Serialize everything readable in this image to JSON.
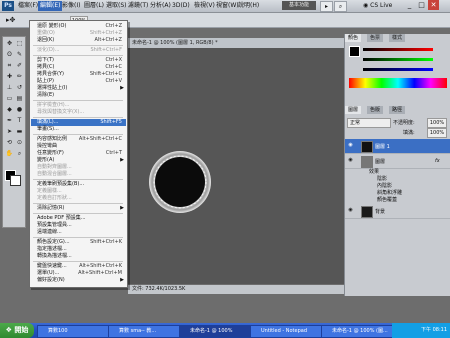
{
  "menubar": {
    "logo": "Ps",
    "items": [
      {
        "label": "檔案(F)",
        "active": false
      },
      {
        "label": "編輯(E)",
        "active": true
      },
      {
        "label": "影像(I)",
        "active": false
      },
      {
        "label": "圖層(L)",
        "active": false
      },
      {
        "label": "選取(S)",
        "active": false
      },
      {
        "label": "濾鏡(T)",
        "active": false
      },
      {
        "label": "分析(A)",
        "active": false
      },
      {
        "label": "3D(D)",
        "active": false
      },
      {
        "label": "檢視(V)",
        "active": false
      },
      {
        "label": "視窗(W)",
        "active": false
      },
      {
        "label": "說明(H)",
        "active": false
      }
    ],
    "workspace": "基本功能",
    "cs_live": "CS Live"
  },
  "options": {
    "zoom": "100%"
  },
  "document": {
    "tab": "未命名-1 @ 100% (圖層 1, RGB/8) *",
    "status": "文件: 732.4K/1023.5K"
  },
  "edit_menu": {
    "items": [
      {
        "label": "還原 變形(O)",
        "shortcut": "Ctrl+Z",
        "disabled": false
      },
      {
        "label": "重做(O)",
        "shortcut": "Shift+Ctrl+Z",
        "disabled": true
      },
      {
        "label": "退回(K)",
        "shortcut": "Alt+Ctrl+Z",
        "disabled": false
      },
      {
        "sep": true
      },
      {
        "label": "淡化(D)...",
        "shortcut": "Shift+Ctrl+F",
        "disabled": true
      },
      {
        "sep": true
      },
      {
        "label": "剪下(T)",
        "shortcut": "Ctrl+X",
        "disabled": false
      },
      {
        "label": "拷貝(C)",
        "shortcut": "Ctrl+C",
        "disabled": false
      },
      {
        "label": "拷貝合併(Y)",
        "shortcut": "Shift+Ctrl+C",
        "disabled": false
      },
      {
        "label": "貼上(P)",
        "shortcut": "Ctrl+V",
        "disabled": false
      },
      {
        "label": "選擇性貼上(I)",
        "shortcut": "",
        "disabled": false,
        "submenu": true
      },
      {
        "label": "清除(E)",
        "shortcut": "",
        "disabled": false
      },
      {
        "sep": true
      },
      {
        "label": "拼字檢查(H)...",
        "shortcut": "",
        "disabled": true
      },
      {
        "label": "尋找與替換文字(X)...",
        "shortcut": "",
        "disabled": true
      },
      {
        "sep": true
      },
      {
        "label": "填滿(L)...",
        "shortcut": "Shift+F5",
        "disabled": false,
        "highlight": true
      },
      {
        "label": "筆畫(S)...",
        "shortcut": "",
        "disabled": false
      },
      {
        "sep": true
      },
      {
        "label": "內容感知比例",
        "shortcut": "Alt+Shift+Ctrl+C",
        "disabled": false
      },
      {
        "label": "操控彎曲",
        "shortcut": "",
        "disabled": false
      },
      {
        "label": "任意變形(F)",
        "shortcut": "Ctrl+T",
        "disabled": false
      },
      {
        "label": "變形(A)",
        "shortcut": "",
        "disabled": false,
        "submenu": true
      },
      {
        "label": "自動對齊圖層...",
        "shortcut": "",
        "disabled": true
      },
      {
        "label": "自動混合圖層...",
        "shortcut": "",
        "disabled": true
      },
      {
        "sep": true
      },
      {
        "label": "定義筆刷預設集(B)...",
        "shortcut": "",
        "disabled": false
      },
      {
        "label": "定義圖樣...",
        "shortcut": "",
        "disabled": true
      },
      {
        "label": "定義自訂形狀...",
        "shortcut": "",
        "disabled": true
      },
      {
        "sep": true
      },
      {
        "label": "清除記憶(R)",
        "shortcut": "",
        "disabled": false,
        "submenu": true
      },
      {
        "sep": true
      },
      {
        "label": "Adobe PDF 預設集...",
        "shortcut": "",
        "disabled": false
      },
      {
        "label": "預設集管理員...",
        "shortcut": "",
        "disabled": false
      },
      {
        "label": "遠端連線...",
        "shortcut": "",
        "disabled": false
      },
      {
        "sep": true
      },
      {
        "label": "顏色設定(G)...",
        "shortcut": "Shift+Ctrl+K",
        "disabled": false
      },
      {
        "label": "指定描述檔...",
        "shortcut": "",
        "disabled": false
      },
      {
        "label": "轉換為描述檔...",
        "shortcut": "",
        "disabled": false
      },
      {
        "sep": true
      },
      {
        "label": "鍵盤快速鍵...",
        "shortcut": "Alt+Shift+Ctrl+K",
        "disabled": false
      },
      {
        "label": "選單(U)...",
        "shortcut": "Alt+Shift+Ctrl+M",
        "disabled": false
      },
      {
        "label": "偏好設定(N)",
        "shortcut": "",
        "disabled": false,
        "submenu": true
      }
    ]
  },
  "panels": {
    "color_tabs": [
      "顏色",
      "色票",
      "樣式"
    ],
    "layers_tabs": [
      "圖層",
      "色版",
      "路徑"
    ],
    "blend_mode": "正常",
    "opacity_label": "不透明度:",
    "opacity": "100%",
    "fill_label": "填滿:",
    "fill": "100%",
    "layers": [
      {
        "name": "圖層 1",
        "selected": true
      },
      {
        "name": "圖層",
        "selected": false,
        "fx": "fx"
      },
      {
        "name": "背景",
        "selected": false
      }
    ],
    "effects_header": "效果",
    "effects": [
      "陰影",
      "內陰影",
      "斜角和浮雕",
      "顏色覆蓋"
    ]
  },
  "taskbar": {
    "start": "開始",
    "tasks": [
      {
        "label": "算數100",
        "active": false
      },
      {
        "label": "算數 sma-- 教...",
        "active": false
      },
      {
        "label": "未命名-1 @ 100%",
        "active": true
      },
      {
        "label": "Untitled - Notepad",
        "active": false
      },
      {
        "label": "未命名-1 @ 100% (圖...",
        "active": false
      }
    ],
    "time": "下午 08:11"
  },
  "colors": {
    "accent": "#3a73c6",
    "taskbar": "#2453c3"
  }
}
